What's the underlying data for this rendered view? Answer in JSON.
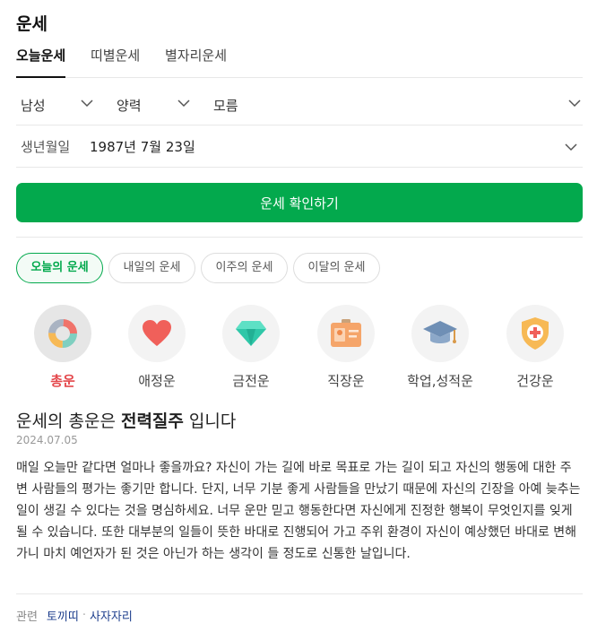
{
  "title": "운세",
  "tabs": [
    {
      "label": "오늘운세",
      "active": true
    },
    {
      "label": "띠별운세",
      "active": false
    },
    {
      "label": "별자리운세",
      "active": false
    }
  ],
  "form": {
    "gender": "남성",
    "calendar": "양력",
    "time": "모름",
    "birth_label": "생년월일",
    "birth_value": "1987년 7월 23일",
    "confirm_label": "운세 확인하기"
  },
  "periods": [
    {
      "label": "오늘의 운세",
      "active": true
    },
    {
      "label": "내일의 운세",
      "active": false
    },
    {
      "label": "이주의 운세",
      "active": false
    },
    {
      "label": "이달의 운세",
      "active": false
    }
  ],
  "categories": [
    {
      "label": "총운",
      "icon": "overall-donut-icon",
      "active": true
    },
    {
      "label": "애정운",
      "icon": "heart-icon",
      "active": false
    },
    {
      "label": "금전운",
      "icon": "gem-icon",
      "active": false
    },
    {
      "label": "직장운",
      "icon": "id-badge-icon",
      "active": false
    },
    {
      "label": "학업,성적운",
      "icon": "graduation-cap-icon",
      "active": false
    },
    {
      "label": "건강운",
      "icon": "health-shield-icon",
      "active": false
    }
  ],
  "fortune": {
    "headline_prefix": "운세의 총운은 ",
    "headline_bold": "전력질주",
    "headline_suffix": " 입니다",
    "date": "2024.07.05",
    "text": "매일 오늘만 같다면 얼마나 좋을까요? 자신이 가는 길에 바로 목표로 가는 길이 되고 자신의 행동에 대한 주변 사람들의 평가는 좋기만 합니다. 단지, 너무 기분 좋게 사람들을 만났기 때문에 자신의 긴장을 아예 늦추는 일이 생길 수 있다는 것을 명심하세요. 너무 운만 믿고 행동한다면 자신에게 진정한 행복이 무엇인지를 잊게 될 수 있습니다. 또한 대부분의 일들이 뜻한 바대로 진행되어 가고 주위 환경이 자신이 예상했던 바대로 변해가니 마치 예언자가 된 것은 아닌가 하는 생각이 들 정도로 신통한 날입니다."
  },
  "related": {
    "label": "관련",
    "links": [
      "토끼띠",
      "사자자리"
    ],
    "separator": "·"
  },
  "colors": {
    "accent_green": "#03a94d",
    "active_red": "#e4484c",
    "link_blue": "#1c3d8c"
  }
}
